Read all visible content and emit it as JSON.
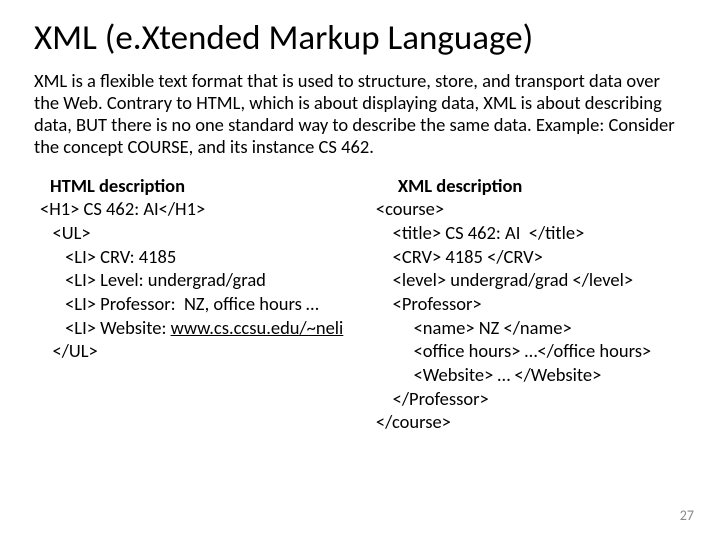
{
  "title": "XML (e.Xtended Markup Language)",
  "intro": "XML is a flexible text format that is used to structure, store, and transport data over the Web. Contrary to HTML, which is about displaying data, XML is about describing data, BUT there is no one standard way to describe the same data. Example: Consider the concept COURSE, and its instance CS 462.",
  "left": {
    "header": "HTML description",
    "l1": "<H1> CS 462: AI</H1>",
    "l2": "   <UL>",
    "l3": "      <LI> CRV: 4185",
    "l4": "      <LI> Level: undergrad/grad",
    "l5": "      <LI> Professor:  NZ, office hours …",
    "l6_a": "      <LI> Website: ",
    "l6_link": "www.cs.ccsu.edu/~neli",
    "l7": "   </UL>"
  },
  "right": {
    "header": "XML description",
    "l1": "<course>",
    "l2": "    <title> CS 462: AI  </title>",
    "l3": "    <CRV> 4185 </CRV>",
    "l4": "    <level> undergrad/grad </level>",
    "l5": "    <Professor>",
    "l6": "         <name> NZ </name>",
    "l7": "         <office hours> …</office hours>",
    "l8": "         <Website> … </Website>",
    "l9": "    </Professor>",
    "l10": "</course>"
  },
  "page_number": "27"
}
